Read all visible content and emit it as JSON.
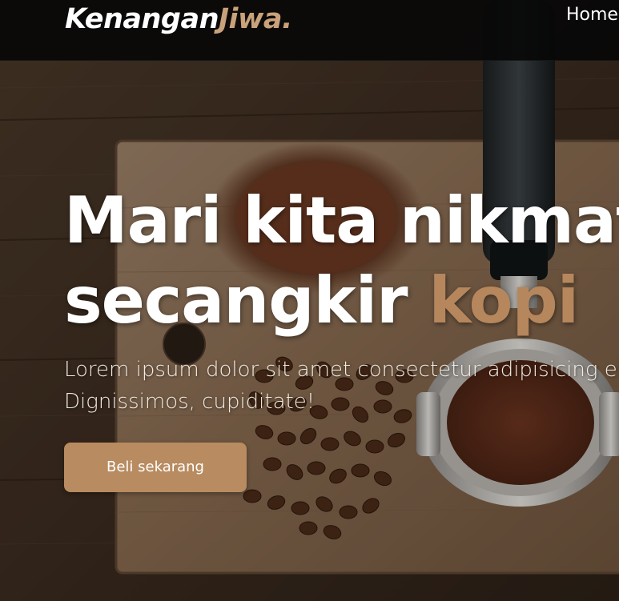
{
  "navbar": {
    "logo_main": "Kenangan",
    "logo_accent": "Jiwa",
    "logo_dot": ".",
    "links": [
      {
        "label": "Home"
      }
    ]
  },
  "hero": {
    "title_line1": "Mari kita nikmati",
    "title_line2_plain": "secangkir ",
    "title_line2_highlight": "kopi",
    "description_line1": "Lorem ipsum dolor sit amet consectetur adipisicing elit.",
    "description_line2": "Dignissimos, cupiditate!",
    "cta_label": "Beli sekarang"
  },
  "colors": {
    "accent": "#b6865c",
    "button": "#b88b60",
    "navbar_bg": "#080808",
    "text": "#ffffff"
  }
}
